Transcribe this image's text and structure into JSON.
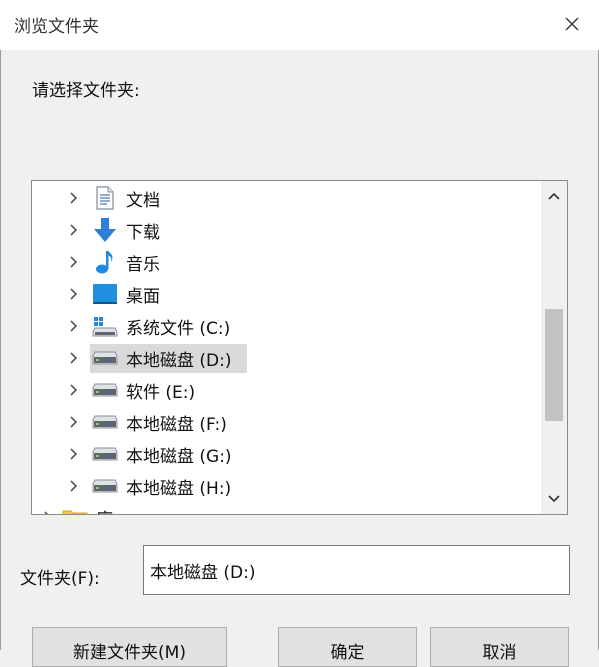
{
  "window": {
    "title": "浏览文件夹",
    "close_glyph": "✕"
  },
  "dialog": {
    "prompt": "请选择文件夹:"
  },
  "tree": {
    "items": [
      {
        "label": "文档",
        "icon": "document-icon"
      },
      {
        "label": "下载",
        "icon": "download-icon"
      },
      {
        "label": "音乐",
        "icon": "music-icon"
      },
      {
        "label": "桌面",
        "icon": "desktop-icon"
      },
      {
        "label": "系统文件 (C:)",
        "icon": "system-drive-icon"
      },
      {
        "label": "本地磁盘 (D:)",
        "icon": "drive-icon",
        "selected": true
      },
      {
        "label": "软件 (E:)",
        "icon": "drive-icon"
      },
      {
        "label": "本地磁盘 (F:)",
        "icon": "drive-icon"
      },
      {
        "label": "本地磁盘 (G:)",
        "icon": "drive-icon"
      },
      {
        "label": "本地磁盘 (H:)",
        "icon": "drive-icon"
      },
      {
        "label": "库",
        "icon": "library-icon"
      }
    ],
    "selection_color": "#d9d9d9"
  },
  "folder_field": {
    "label": "文件夹(F):",
    "value": "本地磁盘 (D:)"
  },
  "buttons": {
    "new_folder": "新建文件夹(M)",
    "ok": "确定",
    "cancel": "取消"
  },
  "colors": {
    "window_bg": "#f0f0f0",
    "titlebar_bg": "#ffffff",
    "download_blue": "#2f7fd6",
    "desktop_blue": "#1f8fe0"
  }
}
